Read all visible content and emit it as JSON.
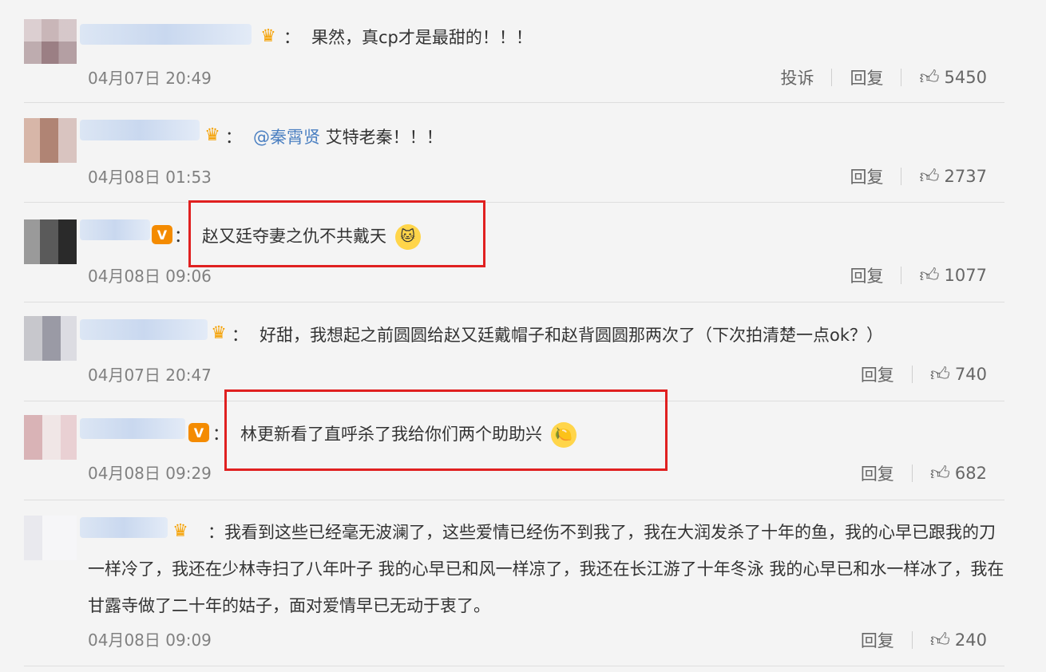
{
  "comments": [
    {
      "text": "果然，真cp才是最甜的！！！",
      "date": "04月07日 20:49",
      "report": "投诉",
      "reply": "回复",
      "likes": "5450"
    },
    {
      "mention": "@秦霄贤",
      "text": "艾特老秦！！！",
      "date": "04月08日 01:53",
      "reply": "回复",
      "likes": "2737"
    },
    {
      "text": "赵又廷夺妻之仇不共戴天",
      "date": "04月08日 09:06",
      "reply": "回复",
      "likes": "1077"
    },
    {
      "text": "好甜，我想起之前圆圆给赵又廷戴帽子和赵背圆圆那两次了（下次拍清楚一点ok？）",
      "date": "04月07日 20:47",
      "reply": "回复",
      "likes": "740"
    },
    {
      "text": "林更新看了直呼杀了我给你们两个助助兴",
      "date": "04月08日 09:29",
      "reply": "回复",
      "likes": "682"
    },
    {
      "text": "我看到这些已经毫无波澜了，这些爱情已经伤不到我了，我在大润发杀了十年的鱼，我的心早已跟我的刀一样冷了，我还在少林寺扫了八年叶子 我的心早已和风一样凉了，我还在长江游了十年冬泳 我的心早已和水一样冰了，我在甘露寺做了二十年的姑子，面对爱情早已无动于衷了。",
      "date": "04月08日 09:09",
      "reply": "回复",
      "likes": "240"
    }
  ],
  "colon": "：",
  "badges": {
    "crown": "♛",
    "v": "V"
  },
  "icons": {
    "like": "thumbs-up-icon"
  },
  "colors": {
    "mention": "#4a7fc1",
    "highlight": "#e02020",
    "badge_v": "#f48b00"
  }
}
